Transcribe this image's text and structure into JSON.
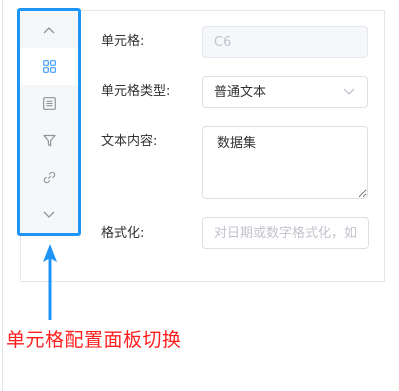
{
  "rail": {
    "items": [
      {
        "icon": "chevron-up-icon",
        "active": false
      },
      {
        "icon": "grid-icon",
        "active": true
      },
      {
        "icon": "list-icon",
        "active": false
      },
      {
        "icon": "filter-icon",
        "active": false
      },
      {
        "icon": "link-icon",
        "active": false
      },
      {
        "icon": "chevron-down-icon",
        "active": false
      }
    ]
  },
  "form": {
    "cell": {
      "label": "单元格:",
      "value": "C6"
    },
    "cell_type": {
      "label": "单元格类型:",
      "value": "普通文本"
    },
    "content": {
      "label": "文本内容:",
      "value": "数据集"
    },
    "format": {
      "label": "格式化:",
      "placeholder": "对日期或数字格式化，如"
    }
  },
  "annotation": {
    "text": "单元格配置面板切换",
    "color": "#ff1f1f",
    "arrow_color": "#1e95f5"
  },
  "colors": {
    "accent": "#409eff",
    "highlight_border": "#1e95f5"
  }
}
